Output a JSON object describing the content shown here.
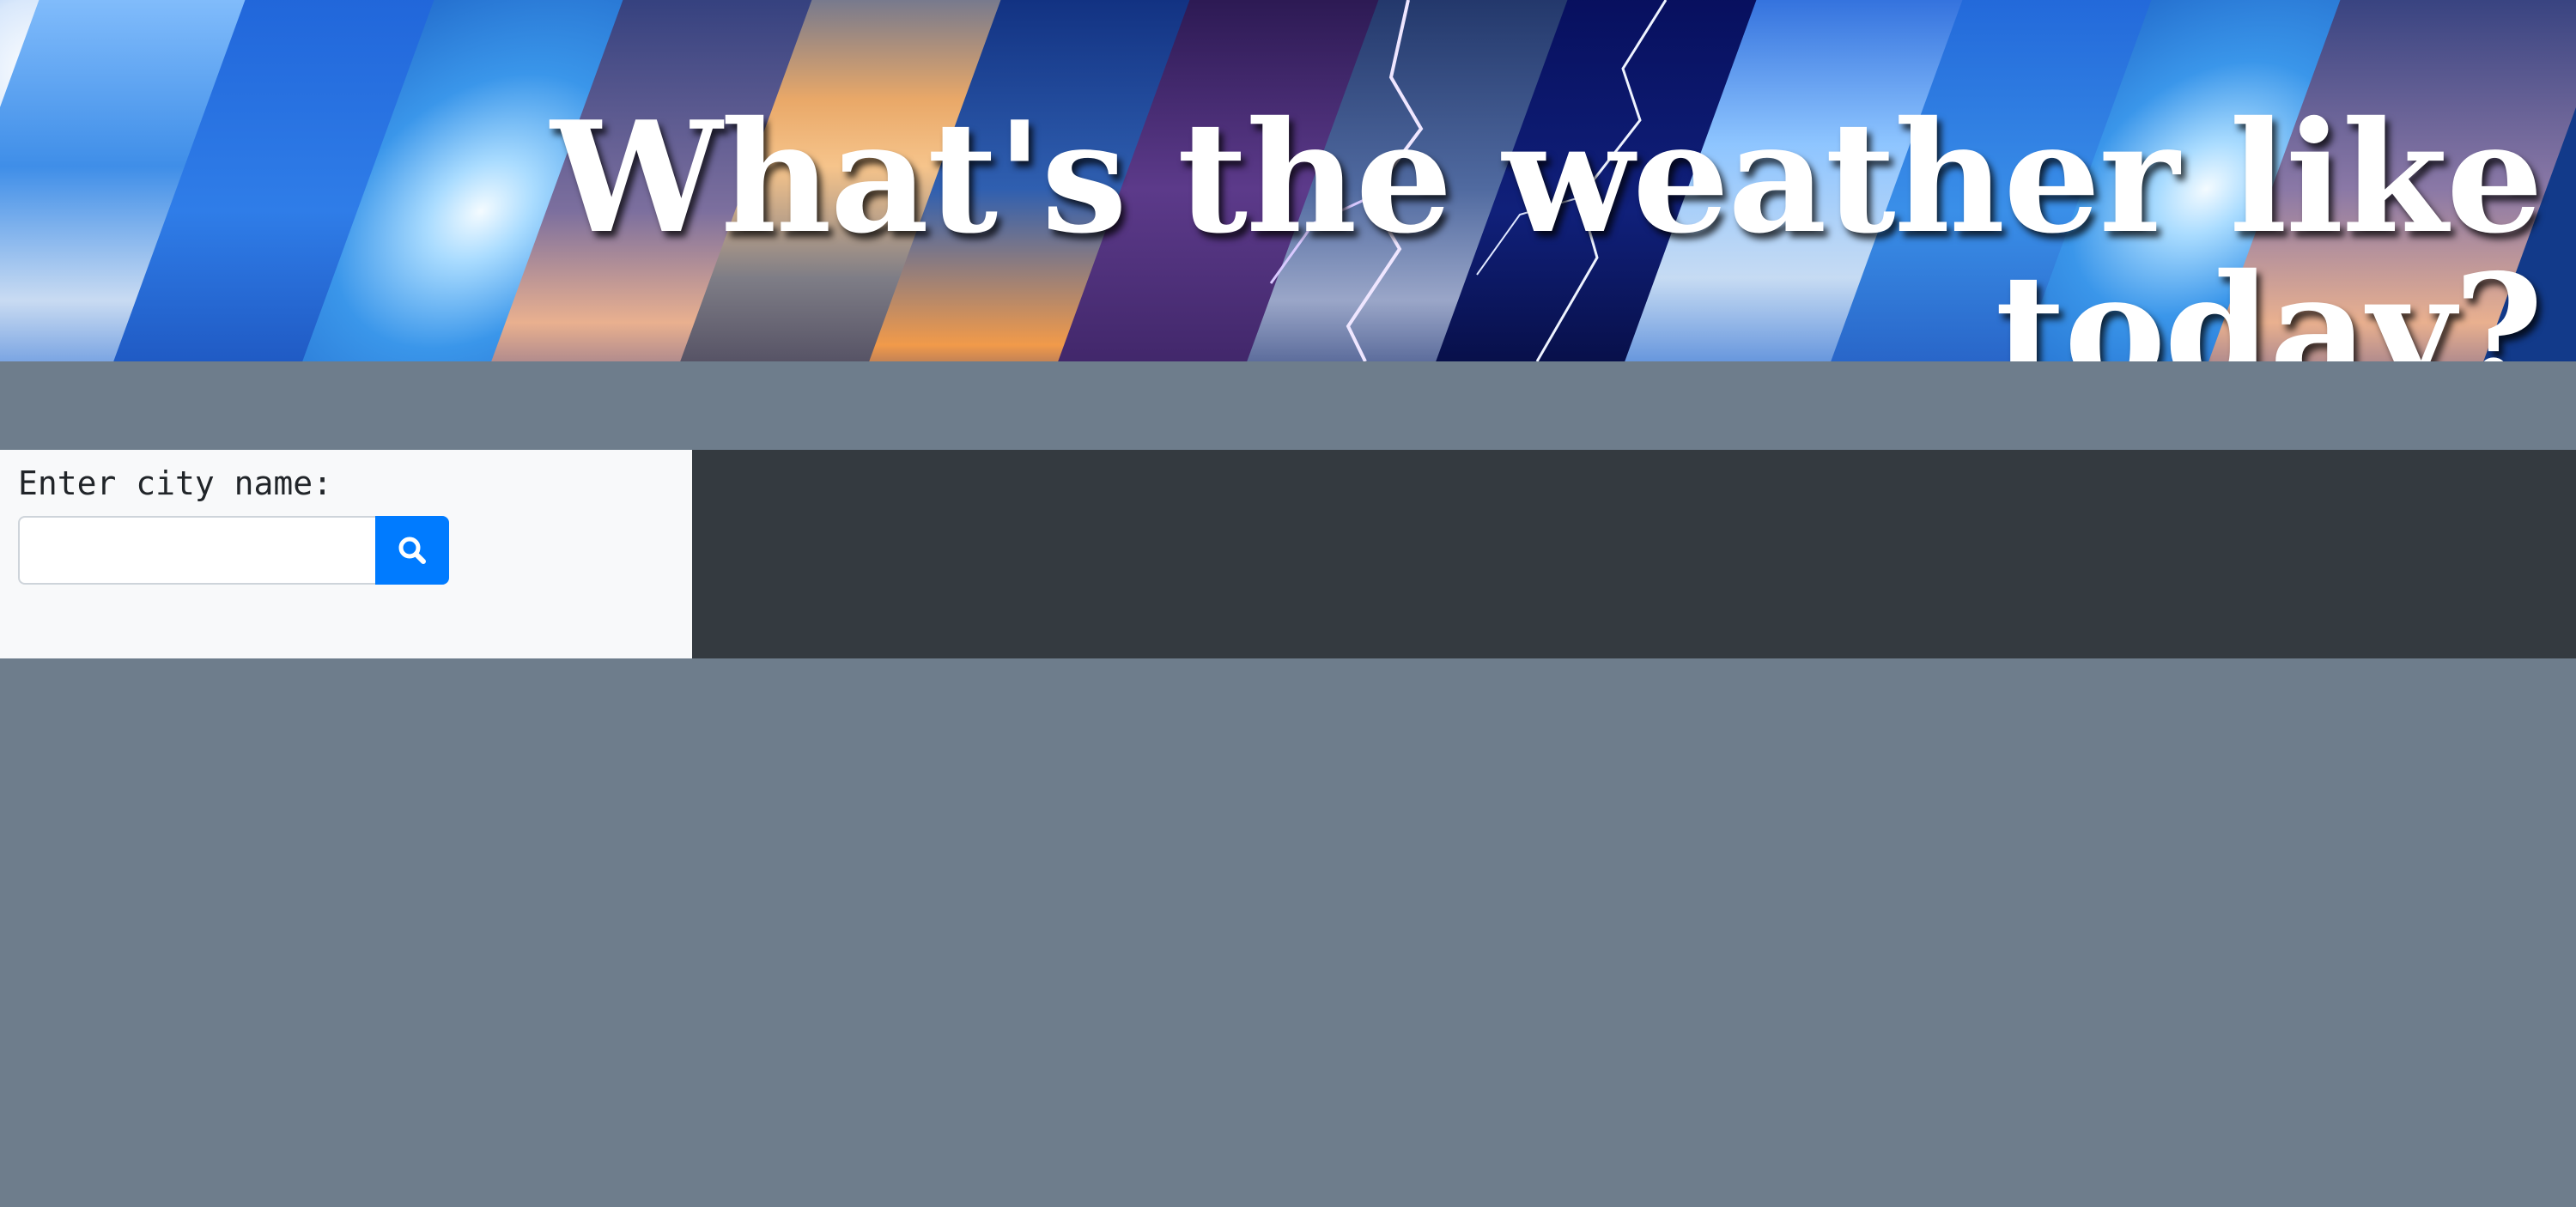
{
  "banner": {
    "title": "What's the weather like today?"
  },
  "search": {
    "label": "Enter city name:",
    "input_value": "",
    "placeholder": "",
    "button_icon": "search-icon"
  },
  "colors": {
    "page_background": "#6e7d8c",
    "search_panel": "#f8f9fa",
    "result_panel": "#343a40",
    "button": "#007bff",
    "title_text": "#ffffff"
  }
}
